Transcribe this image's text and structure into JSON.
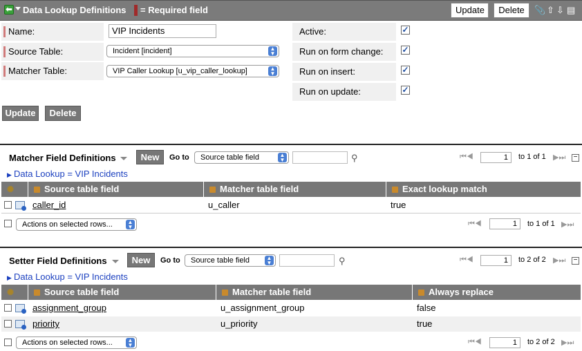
{
  "header": {
    "title": "Data Lookup Definitions",
    "required_note": "= Required field",
    "update_label": "Update",
    "delete_label": "Delete"
  },
  "form": {
    "name_label": "Name:",
    "name_value": "VIP Incidents",
    "source_table_label": "Source Table:",
    "source_table_value": "Incident [incident]",
    "matcher_table_label": "Matcher Table:",
    "matcher_table_value": "VIP Caller Lookup [u_vip_caller_lookup]",
    "active_label": "Active:",
    "active_checked": true,
    "run_form_change_label": "Run on form change:",
    "run_form_change_checked": true,
    "run_insert_label": "Run on insert:",
    "run_insert_checked": true,
    "run_update_label": "Run on update:",
    "run_update_checked": true,
    "update_button": "Update",
    "delete_button": "Delete"
  },
  "matcher_list": {
    "title": "Matcher Field Definitions",
    "new_button": "New",
    "goto_label": "Go to",
    "goto_select": "Source table field",
    "page_value": "1",
    "range_text": "to 1 of 1",
    "breadcrumb": "Data Lookup = VIP Incidents",
    "columns": [
      "Source table field",
      "Matcher table field",
      "Exact lookup match"
    ],
    "rows": [
      {
        "source": "caller_id",
        "matcher": "u_caller",
        "value": "true"
      }
    ],
    "actions_select": "Actions on selected rows...",
    "footer_page": "1",
    "footer_range": "to 1 of 1"
  },
  "setter_list": {
    "title": "Setter Field Definitions",
    "new_button": "New",
    "goto_label": "Go to",
    "goto_select": "Source table field",
    "page_value": "1",
    "range_text": "to 2 of 2",
    "breadcrumb": "Data Lookup = VIP Incidents",
    "columns": [
      "Source table field",
      "Matcher table field",
      "Always replace"
    ],
    "rows": [
      {
        "source": "assignment_group",
        "matcher": "u_assignment_group",
        "value": "false"
      },
      {
        "source": "priority",
        "matcher": "u_priority",
        "value": "true"
      }
    ],
    "actions_select": "Actions on selected rows...",
    "footer_page": "1",
    "footer_range": "to 2 of 2"
  },
  "colors": {
    "header_bg": "#7b7b7b",
    "required_mark": "#a02a2a",
    "link_blue": "#1a3fbf"
  }
}
